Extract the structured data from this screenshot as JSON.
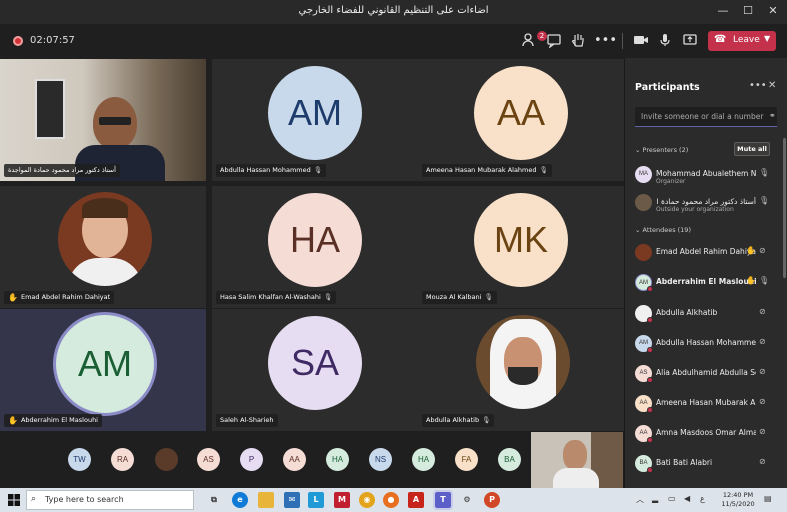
{
  "window": {
    "title": "اضاءات على التنظيم القانوني للفضاء الخارجي",
    "minimize": "—",
    "maximize": "☐",
    "close": "✕"
  },
  "meeting_bar": {
    "timer": "02:07:57",
    "participants_badge": "2",
    "leave_label": "Leave",
    "leave_color": "#c4314b"
  },
  "tiles": [
    {
      "name": "أستاذ دكتور مراد محمود حمادة المواجدة",
      "type": "video"
    },
    {
      "name": "Abdulla Hassan Mohammed",
      "initials": "AM",
      "bg": "#c9d9ec",
      "fg": "#1d3b6b"
    },
    {
      "name": "Ameena Hasan Mubarak Alahmed",
      "initials": "AA",
      "bg": "#f8e1c8",
      "fg": "#6b4313"
    },
    {
      "name": "Emad Abdel Rahim Dahiyat",
      "type": "video"
    },
    {
      "name": "Hasa Salim Khalfan Al-Washahi",
      "initials": "HA",
      "bg": "#f5ddd6",
      "fg": "#5a2f26"
    },
    {
      "name": "Mouza Al Kalbani",
      "initials": "MK",
      "bg": "#f8e1c8",
      "fg": "#6b4313"
    },
    {
      "name": "Abderrahim El Maslouhi",
      "initials": "AM",
      "bg": "#d4ebdd",
      "fg": "#1a5e34"
    },
    {
      "name": "Saleh Al-Sharieh",
      "initials": "SA",
      "bg": "#e6ddf2",
      "fg": "#3f2a63"
    },
    {
      "name": "Abdulla Alkhatib",
      "type": "video"
    }
  ],
  "strip_avatars": [
    "TW",
    "RA",
    "",
    "AS",
    "P",
    "AA",
    "HA",
    "NS",
    "HA",
    "FA",
    "BA"
  ],
  "panel": {
    "title": "Participants",
    "more": "•••",
    "close": "✕",
    "invite_placeholder": "Invite someone or dial a number",
    "presenters_label": "Presenters (2)",
    "mute_all_label": "Mute all",
    "attendees_label": "Attendees (19)",
    "presenters": [
      {
        "initials": "MA",
        "name": "Mohammad Abualethem Nso...",
        "sub": "Organizer"
      },
      {
        "initials": "",
        "name": "أستاذ دكتور مراد محمود حمادة المواجدة",
        "sub": "Outside your organization"
      }
    ],
    "attendees": [
      {
        "initials": "",
        "name": "Emad Abdel Rahim Dahiyat",
        "hand": true
      },
      {
        "initials": "AM",
        "name": "Abderrahim El Maslouhi",
        "hand": true,
        "bold": true
      },
      {
        "initials": "",
        "name": "Abdulla Alkhatib"
      },
      {
        "initials": "AM",
        "name": "Abdulla Hassan Mohammed"
      },
      {
        "initials": "AS",
        "name": "Alia Abdulhamid Abdulla Seraj"
      },
      {
        "initials": "AA",
        "name": "Ameena Hasan Mubarak Alah..."
      },
      {
        "initials": "AA",
        "name": "Amna Masdoos Omar Almash..."
      },
      {
        "initials": "BA",
        "name": "Bati Bati Alabri"
      }
    ]
  },
  "taskbar": {
    "search_placeholder": "Type here to search",
    "time": "12:40 PM",
    "date": "11/5/2020"
  }
}
